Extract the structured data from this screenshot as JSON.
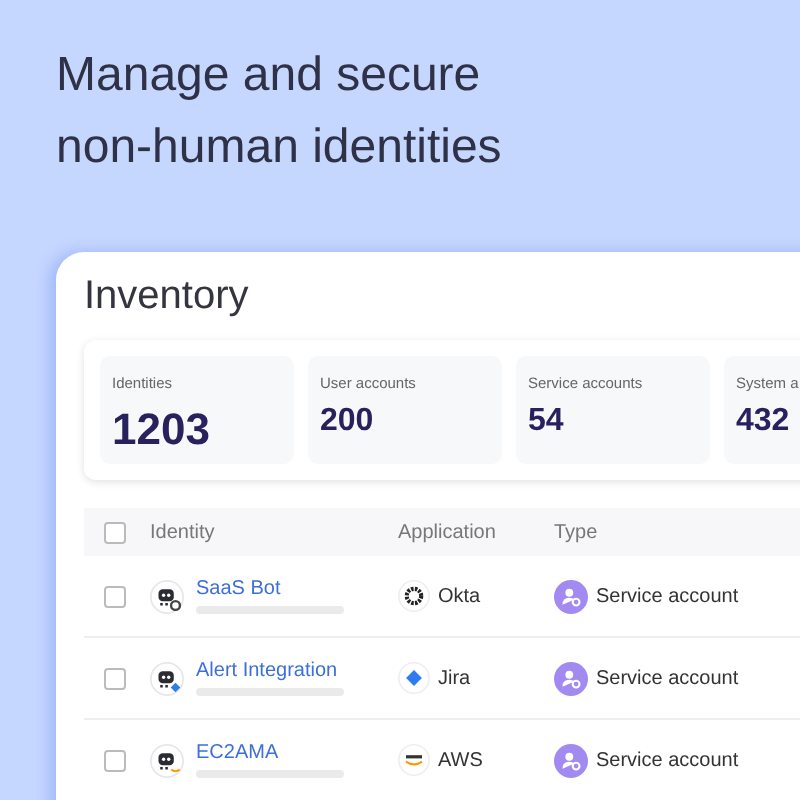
{
  "headline": "Manage and secure non-human identities",
  "panel": {
    "title": "Inventory"
  },
  "stats": [
    {
      "label": "Identities",
      "value": "1203",
      "emphasis": true
    },
    {
      "label": "User accounts",
      "value": "200",
      "emphasis": false
    },
    {
      "label": "Service accounts",
      "value": "54",
      "emphasis": false
    },
    {
      "label": "System a",
      "value": "432",
      "emphasis": false
    }
  ],
  "table": {
    "header_checked": false,
    "columns": [
      "Identity",
      "Application",
      "Type"
    ],
    "rows": [
      {
        "checked": false,
        "identity": "SaaS Bot",
        "kind": "okta",
        "application": "Okta",
        "type": "Service account"
      },
      {
        "checked": false,
        "identity": "Alert Integration",
        "kind": "jira",
        "application": "Jira",
        "type": "Service account"
      },
      {
        "checked": false,
        "identity": "EC2AMA",
        "kind": "aws",
        "application": "AWS",
        "type": "Service account"
      }
    ]
  }
}
